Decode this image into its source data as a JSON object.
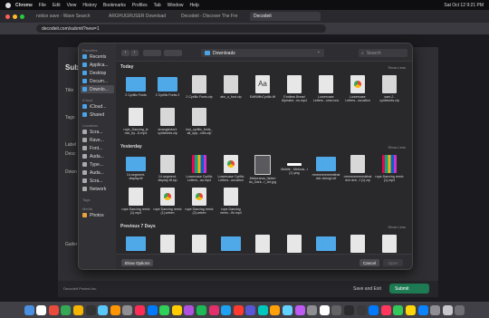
{
  "menubar": {
    "items": [
      "Chrome",
      "File",
      "Edit",
      "View",
      "History",
      "Bookmarks",
      "Profiles",
      "Tab",
      "Window",
      "Help"
    ],
    "clock": "Sat Oct 12  9:21 PM"
  },
  "browser": {
    "tabs": [
      "notice save - Wave Search",
      "ARGHUGRUSER Download",
      "Decodeit - Discover The Fre",
      "Decodeit"
    ],
    "address": "decodeit.com/submit?new=1"
  },
  "page": {
    "title": "Sub",
    "labels": [
      "Title",
      "Tags",
      "Label",
      "Desc",
      "Down",
      "Galler"
    ],
    "footer": {
      "profile": "DecodeIt Protect Inc.",
      "save_label": "Save and Exit",
      "submit_label": "Submit"
    }
  },
  "dialog": {
    "sidebar": {
      "favorites_heading": "Favorites",
      "favorites": [
        {
          "label": "Recents",
          "color": "#4aa3e6"
        },
        {
          "label": "Applica...",
          "color": "#4aa3e6"
        },
        {
          "label": "Desktop",
          "color": "#4aa3e6"
        },
        {
          "label": "Docum...",
          "color": "#4aa3e6"
        },
        {
          "label": "Downlo...",
          "color": "#4aa3e6"
        }
      ],
      "icloud_heading": "iCloud",
      "icloud": [
        {
          "label": "iCloud...",
          "color": "#4aa3e6"
        },
        {
          "label": "Shared",
          "color": "#4aa3e6"
        }
      ],
      "locations_heading": "Locations",
      "locations": [
        {
          "label": "Scra...",
          "color": "#aaaaaa"
        },
        {
          "label": "Rave...",
          "color": "#aaaaaa"
        },
        {
          "label": "Font...",
          "color": "#aaaaaa"
        },
        {
          "label": "Auda...",
          "color": "#aaaaaa"
        },
        {
          "label": "Type...",
          "color": "#aaaaaa"
        },
        {
          "label": "Auda...",
          "color": "#aaaaaa"
        },
        {
          "label": "Scra...",
          "color": "#aaaaaa"
        },
        {
          "label": "Network",
          "color": "#aaaaaa"
        }
      ],
      "tags_heading": "Tags",
      "media_heading": "Media",
      "media": [
        {
          "label": "Photos",
          "color": "#e8a23c"
        }
      ]
    },
    "location": "Downloads",
    "search_placeholder": "Search",
    "sections": [
      {
        "heading": "Today",
        "show_less": "Show Less",
        "rows": [
          [
            {
              "name": "2 Cyrillic Fonts",
              "meta": "2 items",
              "kind": "folder"
            },
            {
              "name": "2 Cyrillic Fonts 2",
              "meta": "2 items",
              "kind": "folder"
            },
            {
              "name": "2 Cyrillic Fonts.zip",
              "meta": "",
              "kind": "zip"
            },
            {
              "name": "abc_s_font.zip",
              "meta": "",
              "kind": "zip"
            },
            {
              "name": "EditWithCyrillic.ttf",
              "meta": "",
              "kind": "font"
            },
            {
              "name": "Endless Bread Alphabe...ns.mp4",
              "meta": "",
              "kind": "doc"
            },
            {
              "name": "Lowercase Letters...ums.mov",
              "meta": "",
              "kind": "doc"
            },
            {
              "name": "Lowercase Letters...ouvation",
              "meta": "",
              "kind": "chrome"
            },
            {
              "name": "sam-2-cyrilcfonts.zip",
              "meta": "",
              "kind": "zip"
            }
          ],
          [
            {
              "name": "rope_Dancing_ie mix_by...D.mp4",
              "meta": "",
              "kind": "doc"
            },
            {
              "name": "sixangleduv1 cyrilcfonts.zip",
              "meta": "",
              "kind": "zip"
            },
            {
              "name": "two_cyrillic_fonts_ all_upp...rolls.zip",
              "meta": "",
              "kind": "zip"
            }
          ]
        ]
      },
      {
        "heading": "Yesterday",
        "show_less": "Show Less",
        "rows": [
          [
            {
              "name": "14-segment-display.ttf",
              "meta": "",
              "kind": "folder"
            },
            {
              "name": "14-segment-display-ttf.zip",
              "meta": "",
              "kind": "zip"
            },
            {
              "name": "Lowercase Cyrillic Letters...ao.mp4",
              "meta": "",
              "kind": "swatch"
            },
            {
              "name": "Lowercase Cyrillic Letters...ouvation",
              "meta": "",
              "kind": "chrome"
            },
            {
              "name": "Mekorama_hinten do_Dark...r_Art.jpg",
              "meta": "",
              "kind": "img"
            },
            {
              "name": "Mobile - Mekora...l (1).png",
              "meta": "",
              "kind": "white"
            },
            {
              "name": "mmmmmmmmkhat dvir dchegf.otf",
              "meta": "",
              "kind": "folder"
            },
            {
              "name": "mmmmmmmmkhat dvir dch...f (1).zip",
              "meta": "",
              "kind": "zip"
            },
            {
              "name": "rope Dancing remix (1).mp4",
              "meta": "",
              "kind": "swatch"
            }
          ],
          [
            {
              "name": "rope Dancing remix (1).mp4",
              "meta": "",
              "kind": "doc"
            },
            {
              "name": "rope Dancing remix (1).webm",
              "meta": "",
              "kind": "chrome"
            },
            {
              "name": "rope Dancing remix (2).webm",
              "meta": "",
              "kind": "chrome"
            },
            {
              "name": "rope Dancing remix...ifn.mp4",
              "meta": "",
              "kind": "doc"
            }
          ]
        ]
      },
      {
        "heading": "Previous 7 Days",
        "show_less": "Show Less",
        "rows": []
      }
    ],
    "show_options": "Show Options",
    "cancel": "Cancel",
    "open": "Open"
  },
  "dock": {
    "colors": [
      "#4a90e2",
      "#ffffff",
      "#e94b3c",
      "#34a853",
      "#f4b400",
      "#333333",
      "#5ac8fa",
      "#ff9500",
      "#8e8e93",
      "#ff2d55",
      "#007aff",
      "#30d158",
      "#ffcc00",
      "#af52de",
      "#1db954",
      "#e1306c",
      "#1da1f2",
      "#ff3b30",
      "#5856d6",
      "#00c7be",
      "#ff9f0a",
      "#64d2ff",
      "#bf5af2",
      "#8e8e93",
      "#ffffff",
      "#636366",
      "#2c2c2e",
      "#3a3a3c",
      "#007aff",
      "#ff375f",
      "#34c759",
      "#ffd60a",
      "#0a84ff",
      "#8e8e93",
      "#c7c7cc",
      "#6e6e73"
    ]
  }
}
